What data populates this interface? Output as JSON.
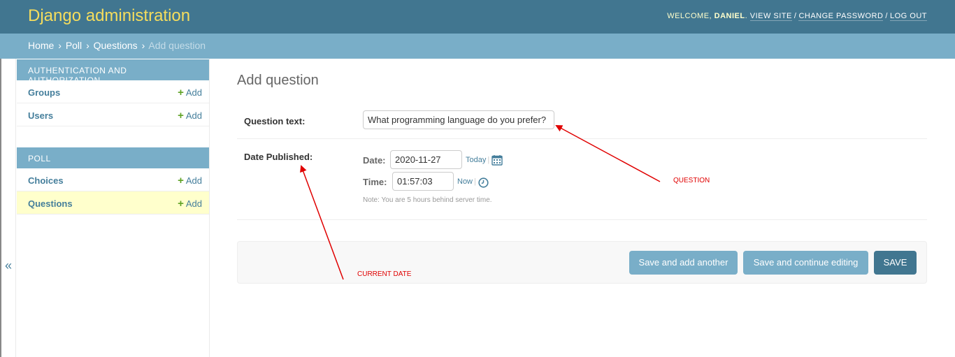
{
  "header": {
    "brand": "Django administration",
    "welcome": "WELCOME,",
    "username": "DANIEL",
    "view_site": "VIEW SITE",
    "change_password": "CHANGE PASSWORD",
    "log_out": "LOG OUT"
  },
  "breadcrumbs": {
    "home": "Home",
    "app": "Poll",
    "model": "Questions",
    "current": "Add question"
  },
  "sidebar": {
    "toggle": "«",
    "modules": [
      {
        "caption": "AUTHENTICATION AND AUTHORIZATION",
        "items": [
          {
            "label": "Groups",
            "add": "Add"
          },
          {
            "label": "Users",
            "add": "Add"
          }
        ]
      },
      {
        "caption": "POLL",
        "items": [
          {
            "label": "Choices",
            "add": "Add"
          },
          {
            "label": "Questions",
            "add": "Add"
          }
        ]
      }
    ]
  },
  "content": {
    "title": "Add question",
    "question_text_label": "Question text:",
    "question_text_value": "What programming language do you prefer?",
    "date_published_label": "Date Published:",
    "date_label": "Date:",
    "date_value": "2020-11-27",
    "today_link": "Today",
    "time_label": "Time:",
    "time_value": "01:57:03",
    "now_link": "Now",
    "help_text": "Note: You are 5 hours behind server time."
  },
  "submit": {
    "save_add_another": "Save and add another",
    "save_continue": "Save and continue editing",
    "save": "SAVE"
  },
  "annotations": {
    "question": "QUESTION",
    "current_date": "CURRENT DATE"
  },
  "colors": {
    "header_bg": "#417690",
    "brand": "#f5dd5d",
    "breadcrumbs_bg": "#79aec8",
    "link": "#447e9b",
    "add_plus": "#5fa225",
    "current_row_bg": "#ffffcc",
    "annotation": "#e00000"
  }
}
